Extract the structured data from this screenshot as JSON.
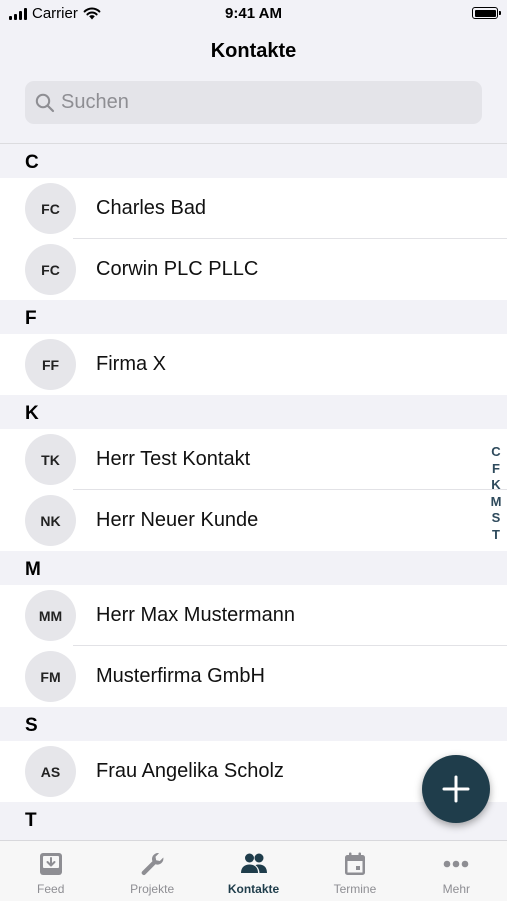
{
  "status_bar": {
    "carrier": "Carrier",
    "time": "9:41 AM"
  },
  "nav": {
    "title": "Kontakte"
  },
  "search": {
    "placeholder": "Suchen"
  },
  "sections": [
    {
      "letter": "C",
      "contacts": [
        {
          "initials": "FC",
          "name": "Charles Bad"
        },
        {
          "initials": "FC",
          "name": "Corwin PLC PLLC"
        }
      ]
    },
    {
      "letter": "F",
      "contacts": [
        {
          "initials": "FF",
          "name": "Firma X"
        }
      ]
    },
    {
      "letter": "K",
      "contacts": [
        {
          "initials": "TK",
          "name": "Herr Test Kontakt"
        },
        {
          "initials": "NK",
          "name": "Herr Neuer Kunde"
        }
      ]
    },
    {
      "letter": "M",
      "contacts": [
        {
          "initials": "MM",
          "name": "Herr Max Mustermann"
        },
        {
          "initials": "FM",
          "name": "Musterfirma GmbH"
        }
      ]
    },
    {
      "letter": "S",
      "contacts": [
        {
          "initials": "AS",
          "name": "Frau Angelika Scholz"
        }
      ]
    },
    {
      "letter": "T",
      "contacts": []
    }
  ],
  "section_index": [
    "C",
    "F",
    "K",
    "M",
    "S",
    "T"
  ],
  "fab": {
    "icon": "plus-icon"
  },
  "tabs": [
    {
      "label": "Feed",
      "icon": "feed-icon",
      "active": false
    },
    {
      "label": "Projekte",
      "icon": "wrench-icon",
      "active": false
    },
    {
      "label": "Kontakte",
      "icon": "people-icon",
      "active": true
    },
    {
      "label": "Termine",
      "icon": "calendar-icon",
      "active": false
    },
    {
      "label": "Mehr",
      "icon": "more-icon",
      "active": false
    }
  ],
  "colors": {
    "accent": "#1f3d4b",
    "inactive_tab": "#8e8e93",
    "background": "#f2f2f7",
    "avatar": "#e6e6ea"
  }
}
